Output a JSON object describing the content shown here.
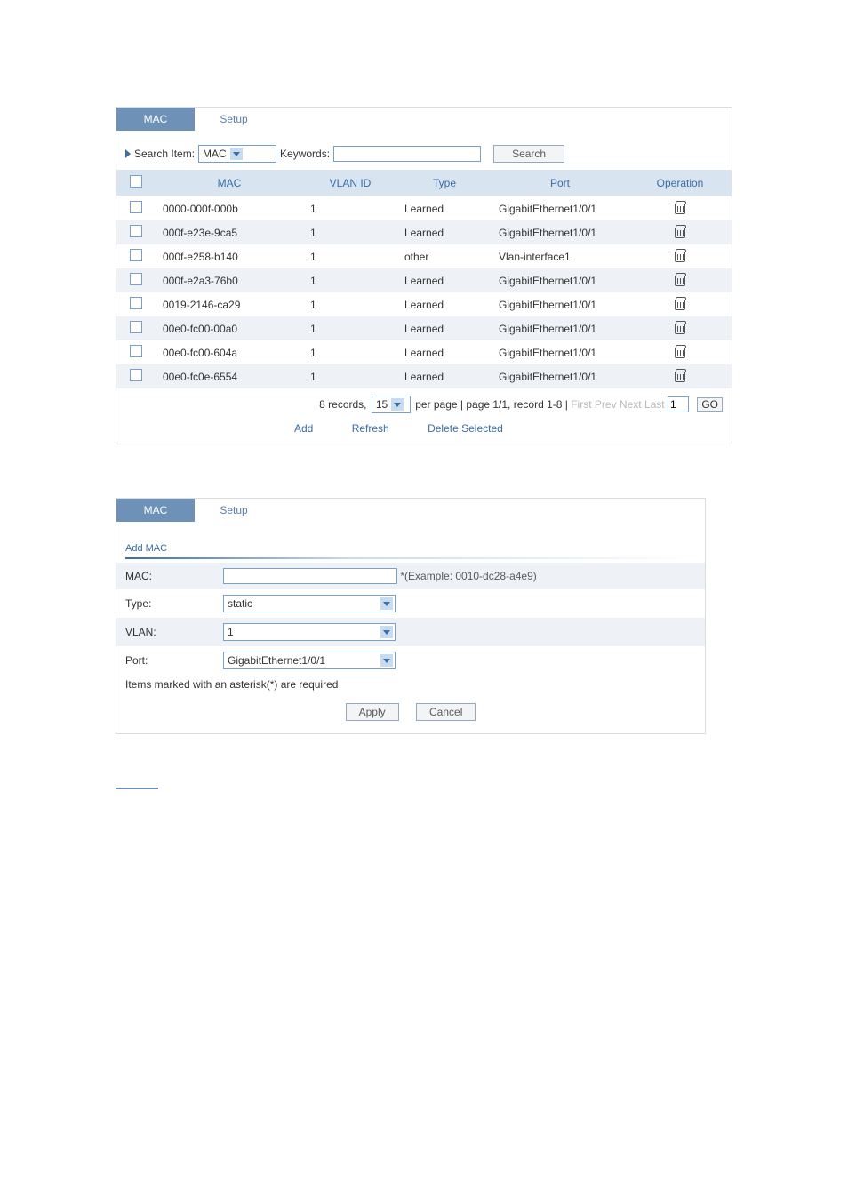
{
  "panel1": {
    "tabs": {
      "active": "MAC",
      "inactive": "Setup"
    },
    "search": {
      "label": "Search Item:",
      "item": "MAC",
      "kw_label": "Keywords:",
      "kw_value": "",
      "button": "Search"
    },
    "columns": {
      "c1": "MAC",
      "c2": "VLAN ID",
      "c3": "Type",
      "c4": "Port",
      "c5": "Operation"
    },
    "rows": [
      {
        "mac": "0000-000f-000b",
        "vlan": "1",
        "type": "Learned",
        "port": "GigabitEthernet1/0/1"
      },
      {
        "mac": "000f-e23e-9ca5",
        "vlan": "1",
        "type": "Learned",
        "port": "GigabitEthernet1/0/1"
      },
      {
        "mac": "000f-e258-b140",
        "vlan": "1",
        "type": "other",
        "port": "Vlan-interface1"
      },
      {
        "mac": "000f-e2a3-76b0",
        "vlan": "1",
        "type": "Learned",
        "port": "GigabitEthernet1/0/1"
      },
      {
        "mac": "0019-2146-ca29",
        "vlan": "1",
        "type": "Learned",
        "port": "GigabitEthernet1/0/1"
      },
      {
        "mac": "00e0-fc00-00a0",
        "vlan": "1",
        "type": "Learned",
        "port": "GigabitEthernet1/0/1"
      },
      {
        "mac": "00e0-fc00-604a",
        "vlan": "1",
        "type": "Learned",
        "port": "GigabitEthernet1/0/1"
      },
      {
        "mac": "00e0-fc0e-6554",
        "vlan": "1",
        "type": "Learned",
        "port": "GigabitEthernet1/0/1"
      }
    ],
    "pager": {
      "records_prefix": "8 records,",
      "perpage": "15",
      "mid": "per page | page 1/1, record 1-8 |",
      "first": "First",
      "prev": "Prev",
      "next": "Next",
      "last": "Last",
      "page_in": "1",
      "go": "GO"
    },
    "actions": {
      "add": "Add",
      "refresh": "Refresh",
      "del": "Delete Selected"
    }
  },
  "panel2": {
    "tabs": {
      "active": "MAC",
      "inactive": "Setup"
    },
    "section": "Add MAC",
    "form": {
      "mac_label": "MAC:",
      "mac_value": "",
      "mac_hint": "*(Example: 0010-dc28-a4e9)",
      "type_label": "Type:",
      "type_value": "static",
      "vlan_label": "VLAN:",
      "vlan_value": "1",
      "port_label": "Port:",
      "port_value": "GigabitEthernet1/0/1"
    },
    "note": "Items marked with an asterisk(*) are required",
    "buttons": {
      "apply": "Apply",
      "cancel": "Cancel"
    }
  }
}
